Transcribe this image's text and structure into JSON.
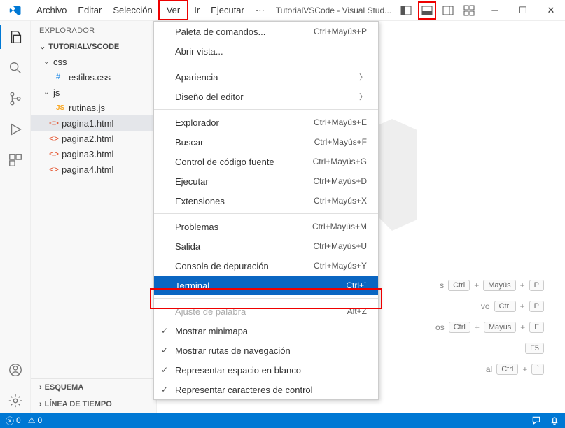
{
  "menubar": {
    "archivo": "Archivo",
    "editar": "Editar",
    "seleccion": "Selección",
    "ver": "Ver",
    "ir": "Ir",
    "ejecutar": "Ejecutar",
    "mas": "···"
  },
  "title": "TutorialVSCode - Visual Stud...",
  "explorer": {
    "title": "EXPLORADOR",
    "project": "TUTORIALVSCODE",
    "folders": {
      "css": "css",
      "js": "js"
    },
    "files": {
      "estilos": "estilos.css",
      "rutinas": "rutinas.js",
      "pagina1": "pagina1.html",
      "pagina2": "pagina2.html",
      "pagina3": "pagina3.html",
      "pagina4": "pagina4.html"
    },
    "esquema": "ESQUEMA",
    "linea": "LÍNEA DE TIEMPO"
  },
  "dropdown": {
    "paleta": {
      "label": "Paleta de comandos...",
      "shortcut": "Ctrl+Mayús+P"
    },
    "abrir": {
      "label": "Abrir vista..."
    },
    "apariencia": {
      "label": "Apariencia"
    },
    "diseno": {
      "label": "Diseño del editor"
    },
    "explorador": {
      "label": "Explorador",
      "shortcut": "Ctrl+Mayús+E"
    },
    "buscar": {
      "label": "Buscar",
      "shortcut": "Ctrl+Mayús+F"
    },
    "control": {
      "label": "Control de código fuente",
      "shortcut": "Ctrl+Mayús+G"
    },
    "ejecutar": {
      "label": "Ejecutar",
      "shortcut": "Ctrl+Mayús+D"
    },
    "extensiones": {
      "label": "Extensiones",
      "shortcut": "Ctrl+Mayús+X"
    },
    "problemas": {
      "label": "Problemas",
      "shortcut": "Ctrl+Mayús+M"
    },
    "salida": {
      "label": "Salida",
      "shortcut": "Ctrl+Mayús+U"
    },
    "consola": {
      "label": "Consola de depuración",
      "shortcut": "Ctrl+Mayús+Y"
    },
    "terminal": {
      "label": "Terminal",
      "shortcut": "Ctrl+`"
    },
    "ajuste": {
      "label": "Ajuste de palabra",
      "shortcut": "Alt+Z"
    },
    "minimapa": {
      "label": "Mostrar minimapa"
    },
    "rutas": {
      "label": "Mostrar rutas de navegación"
    },
    "espacio": {
      "label": "Representar espacio en blanco"
    },
    "caracteres": {
      "label": "Representar caracteres de control"
    }
  },
  "hints": {
    "h1_suffix": "s",
    "h2_pre": "vo",
    "h3_pre": "os",
    "h4_key": "F5",
    "h5_pre": "al",
    "keys": {
      "ctrl": "Ctrl",
      "mayus": "Mayús",
      "p": "P",
      "f": "F",
      "tilde": "`"
    },
    "plus": "+"
  },
  "status": {
    "errors": "0",
    "warnings": "0"
  }
}
